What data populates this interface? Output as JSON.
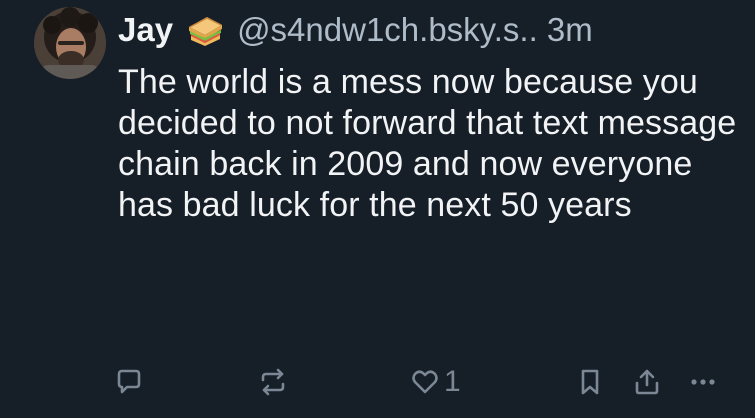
{
  "post": {
    "author": {
      "display_name": "Jay",
      "emoji_icon": "sandwich-emoji-icon",
      "handle": "@s4ndw1ch.bsky.s..",
      "timestamp": "3m"
    },
    "text": "The world is a mess now because you decided to not forward that text message chain back in 2009 and now everyone has bad luck for the next 50 years",
    "actions": {
      "reply_icon": "speech-bubble-icon",
      "repost_icon": "repost-arrows-icon",
      "like_icon": "heart-icon",
      "like_count": "1",
      "bookmark_icon": "bookmark-icon",
      "share_icon": "share-icon",
      "more_icon": "ellipsis-icon"
    }
  },
  "colors": {
    "background": "#161e27",
    "text": "#f1f3f5",
    "secondary_text": "#aebbc9",
    "icon": "#7b8794"
  }
}
